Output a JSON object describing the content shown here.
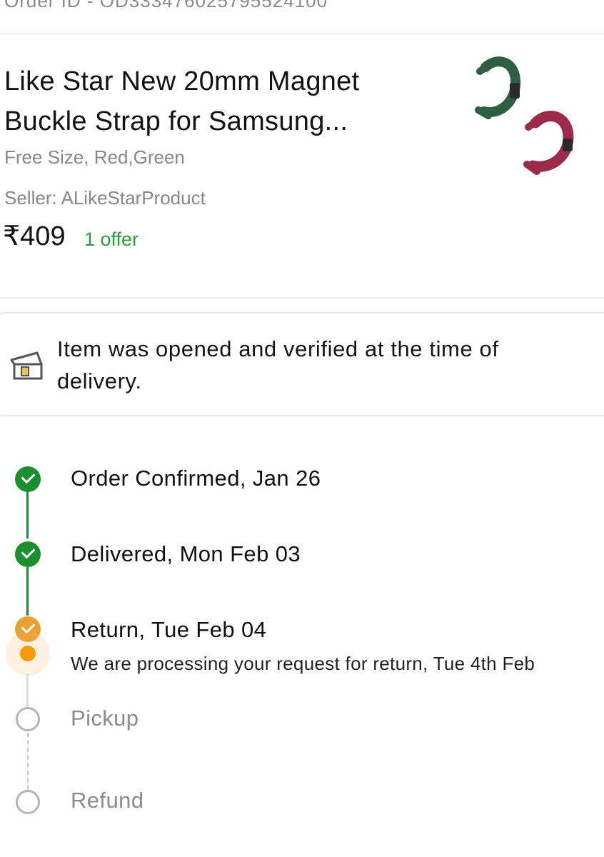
{
  "order": {
    "id_text": "Order ID - OD333476025795524100"
  },
  "product": {
    "title": "Like Star New 20mm Magnet Buckle Strap for Samsung...",
    "variant": "Free Size, Red,Green",
    "seller": "Seller: ALikeStarProduct",
    "price": "₹409",
    "offer": "1 offer",
    "image_icon": "watch-strap-image"
  },
  "verification": {
    "icon": "open-box-icon",
    "text": "Item was opened and verified at the time of delivery."
  },
  "timeline": {
    "steps": [
      {
        "label": "Order Confirmed, Jan 26",
        "status": "done"
      },
      {
        "label": "Delivered, Mon Feb 03",
        "status": "done"
      },
      {
        "label": "Return, Tue Feb 04",
        "status": "active",
        "sub": "We are processing your request for return, Tue 4th Feb"
      },
      {
        "label": "Pickup",
        "status": "pending"
      },
      {
        "label": "Refund",
        "status": "pending"
      }
    ]
  },
  "colors": {
    "green": "#1a8f2e",
    "orange": "#e8a230",
    "offer_green": "#2a9b3c",
    "grey": "#b5b5b5"
  }
}
